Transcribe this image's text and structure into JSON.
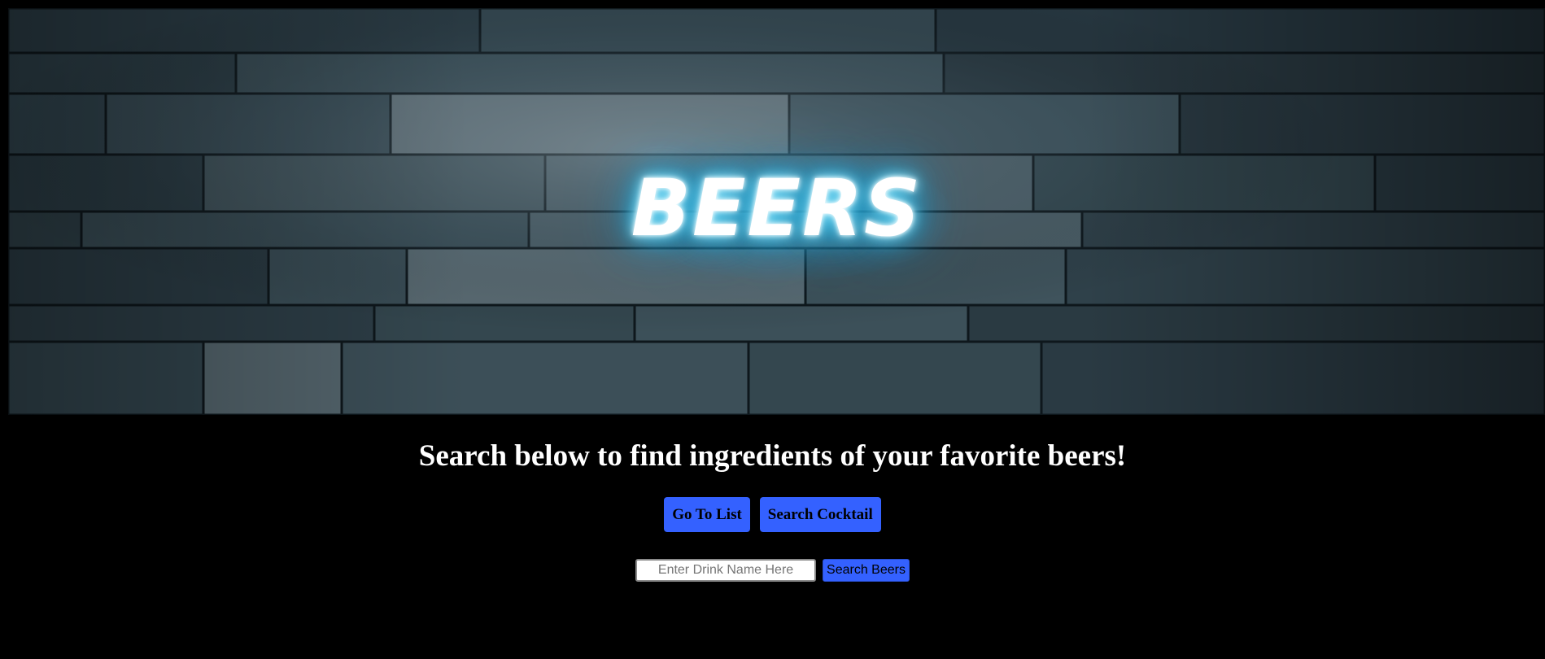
{
  "hero": {
    "neon_text": "BEERS",
    "neon_color": "#39c6f0",
    "background": "dark slate stone wall"
  },
  "main": {
    "tagline": "Search below to find ingredients of your favorite beers!",
    "buttons": {
      "go_to_list": "Go To List",
      "search_cocktail": "Search Cocktail"
    },
    "search": {
      "placeholder": "Enter Drink Name Here",
      "value": "",
      "button_label": "Search Beers"
    }
  },
  "colors": {
    "page_background": "#000000",
    "button": "#3461ff",
    "tagline_text": "#ffffff"
  }
}
